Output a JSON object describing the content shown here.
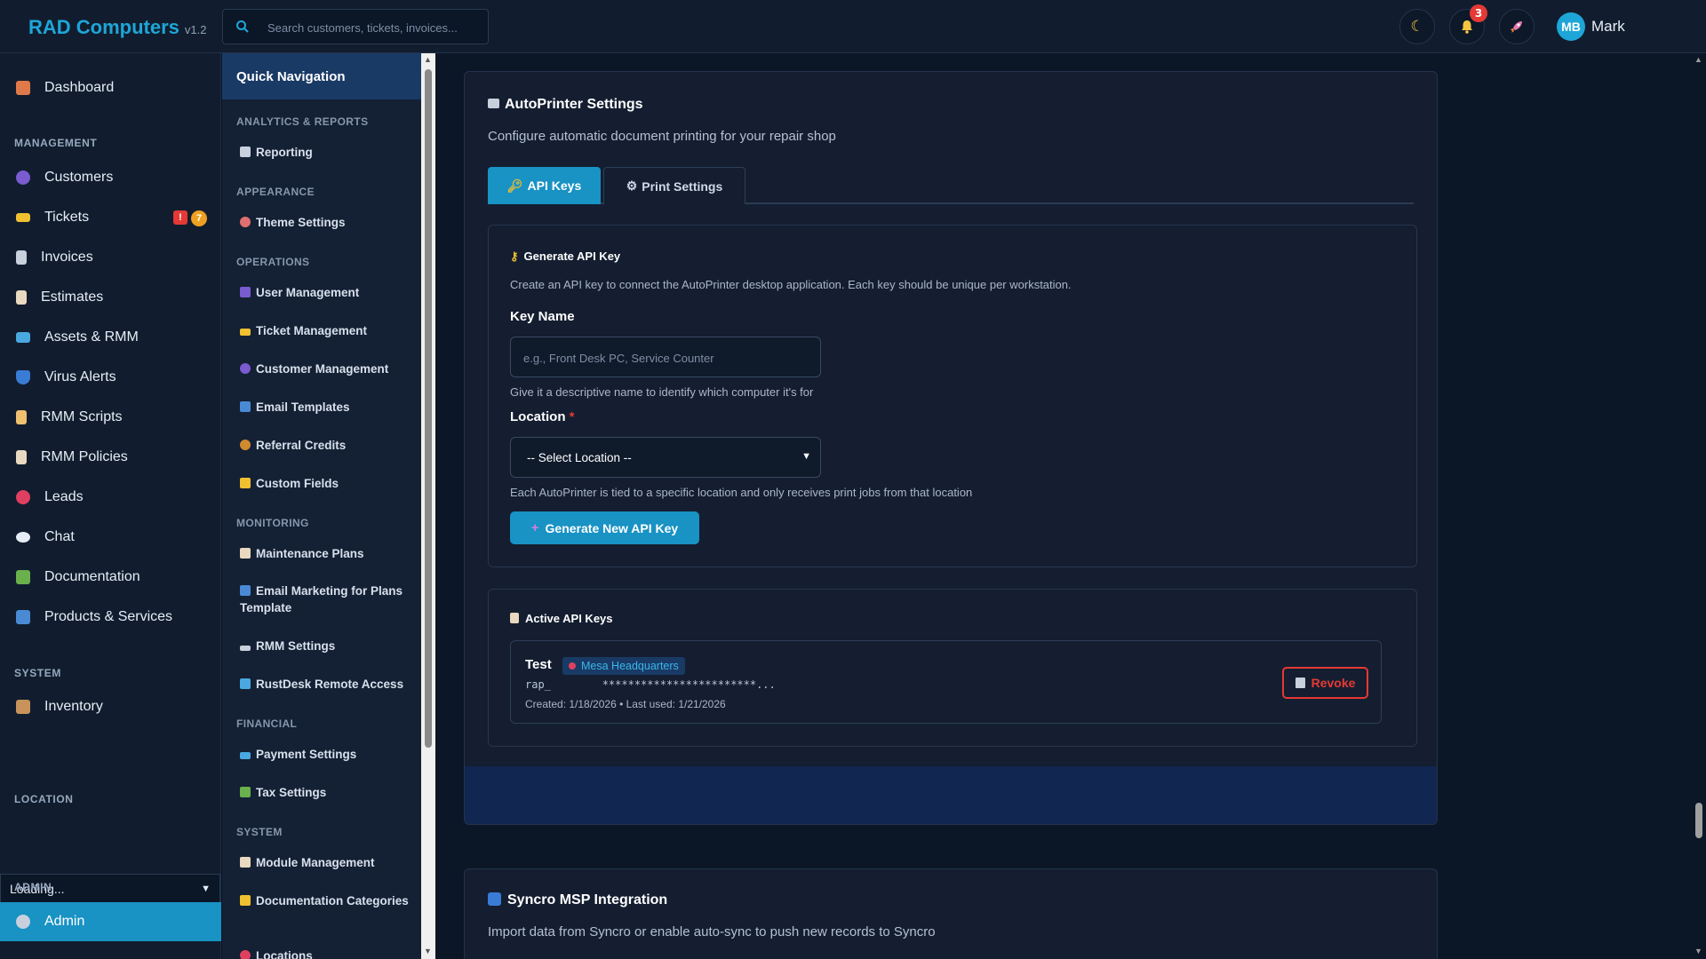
{
  "header": {
    "brand": "RAD Computers",
    "version": "v1.2",
    "search_placeholder": "Search customers, tickets, invoices...",
    "notification_count": "3",
    "user_initials": "MB",
    "user_name": "Mark"
  },
  "sidebar": {
    "dashboard": "Dashboard",
    "management_title": "MANAGEMENT",
    "items": [
      {
        "label": "Customers"
      },
      {
        "label": "Tickets"
      },
      {
        "label": "Invoices"
      },
      {
        "label": "Estimates"
      },
      {
        "label": "Assets & RMM"
      },
      {
        "label": "Virus Alerts"
      },
      {
        "label": "RMM Scripts"
      },
      {
        "label": "RMM Policies"
      },
      {
        "label": "Leads"
      },
      {
        "label": "Chat"
      },
      {
        "label": "Documentation"
      },
      {
        "label": "Products & Services"
      }
    ],
    "ticket_alert_badge": "!",
    "ticket_count_badge": "7",
    "system_title": "SYSTEM",
    "inventory": "Inventory",
    "location_title": "LOCATION",
    "location_value": "Loading...",
    "admin_title": "ADMIN",
    "admin": "Admin"
  },
  "quick_nav": {
    "title": "Quick Navigation",
    "sections": {
      "analytics": "ANALYTICS & REPORTS",
      "appearance": "APPEARANCE",
      "operations": "OPERATIONS",
      "monitoring": "MONITORING",
      "financial": "FINANCIAL",
      "system": "SYSTEM"
    },
    "items": {
      "reporting": "Reporting",
      "theme_settings": "Theme Settings",
      "user_management": "User Management",
      "ticket_management": "Ticket Management",
      "customer_management": "Customer Management",
      "email_templates": "Email Templates",
      "referral_credits": "Referral Credits",
      "custom_fields": "Custom Fields",
      "maintenance_plans": "Maintenance Plans",
      "email_marketing": "Email Marketing for Plans Template",
      "rmm_settings": "RMM Settings",
      "rustdesk": "RustDesk Remote Access",
      "payment_settings": "Payment Settings",
      "tax_settings": "Tax Settings",
      "module_management": "Module Management",
      "documentation_categories": "Documentation Categories",
      "locations": "Locations"
    }
  },
  "autoprinter": {
    "title": "AutoPrinter Settings",
    "subtitle": "Configure automatic document printing for your repair shop",
    "tabs": [
      "API Keys",
      "Print Settings"
    ],
    "generate": {
      "title": "Generate API Key",
      "description": "Create an API key to connect the AutoPrinter desktop application. Each key should be unique per workstation.",
      "key_name_label": "Key Name",
      "key_name_placeholder": "e.g., Front Desk PC, Service Counter",
      "key_name_help": "Give it a descriptive name to identify which computer it's for",
      "location_label": "Location",
      "location_required": "*",
      "location_value": "-- Select Location --",
      "location_help": "Each AutoPrinter is tied to a specific location and only receives print jobs from that location",
      "button": "Generate New API Key"
    },
    "active": {
      "title": "Active API Keys",
      "keys": [
        {
          "name": "Test",
          "location": "Mesa Headquarters",
          "masked": "rap_        ************************...",
          "meta": "Created: 1/18/2026 • Last used: 1/21/2026",
          "revoke": "Revoke"
        }
      ]
    }
  },
  "syncro": {
    "title": "Syncro MSP Integration",
    "subtitle": "Import data from Syncro or enable auto-sync to push new records to Syncro"
  },
  "colors": {
    "accent": "#1992c4",
    "brand": "#1ea6d8",
    "danger": "#e53935",
    "warning": "#f0a020"
  }
}
